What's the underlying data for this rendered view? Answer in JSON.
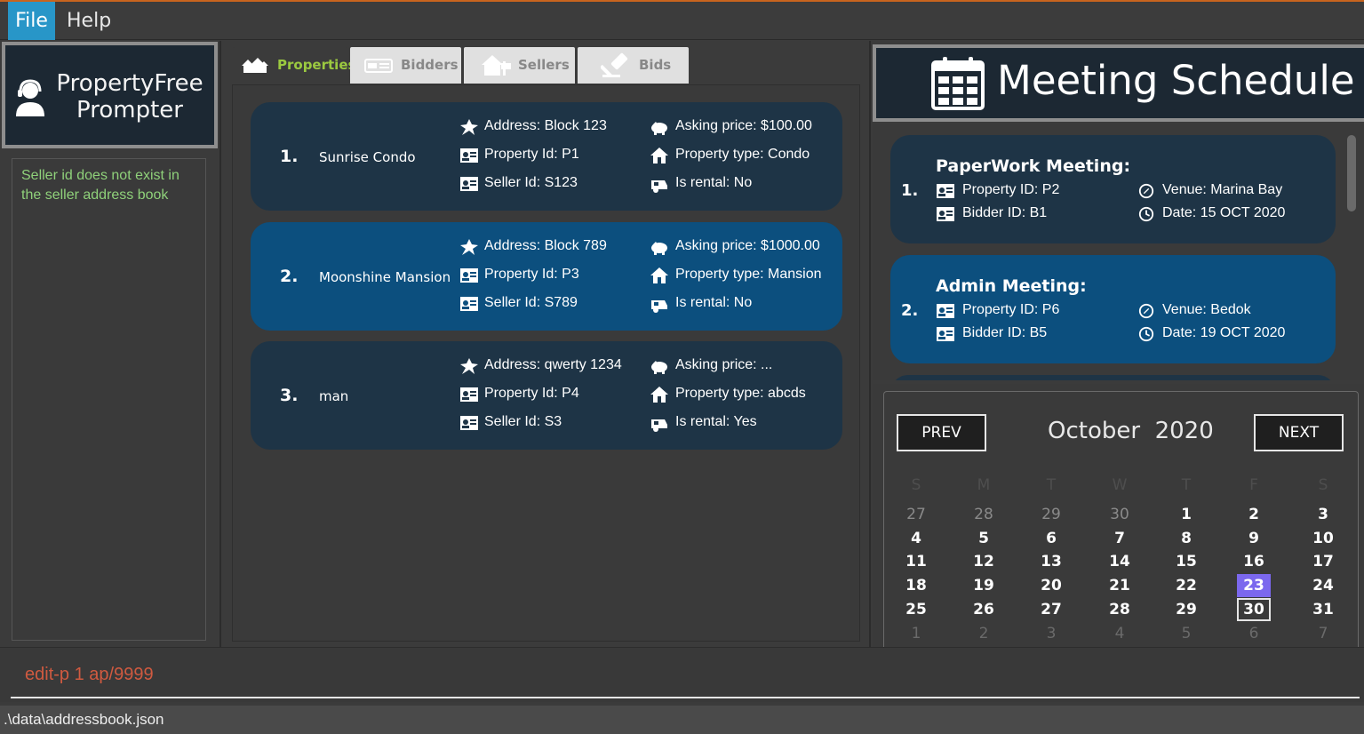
{
  "menu": {
    "items": [
      "File",
      "Help"
    ]
  },
  "app": {
    "title_line1": "PropertyFree",
    "title_line2": "Prompter"
  },
  "result": {
    "message": "Seller id does not exist in the seller address book"
  },
  "tabs": [
    {
      "label": "Properties",
      "icon": "houses-icon",
      "selected": true
    },
    {
      "label": "Bidders",
      "icon": "id-card-icon",
      "selected": false
    },
    {
      "label": "Sellers",
      "icon": "house-sale-icon",
      "selected": false
    },
    {
      "label": "Bids",
      "icon": "gavel-icon",
      "selected": false
    }
  ],
  "properties": [
    {
      "index": "1.",
      "name": "Sunrise Condo",
      "address": "Address: Block 123",
      "property_id": "Property Id: P1",
      "seller_id": "Seller Id: S123",
      "asking_price": "Asking price: $100.00",
      "property_type": "Property type: Condo",
      "is_rental": "Is rental: No",
      "selected": false
    },
    {
      "index": "2.",
      "name": "Moonshine Mansion",
      "address": "Address: Block 789",
      "property_id": "Property Id: P3",
      "seller_id": "Seller Id: S789",
      "asking_price": "Asking price: $1000.00",
      "property_type": "Property type: Mansion",
      "is_rental": "Is rental: No",
      "selected": true
    },
    {
      "index": "3.",
      "name": "man",
      "address": "Address: qwerty 1234",
      "property_id": "Property Id: P4",
      "seller_id": "Seller Id: S3",
      "asking_price": "Asking price: ...",
      "property_type": "Property type: abcds",
      "is_rental": "Is rental: Yes",
      "selected": false
    }
  ],
  "meeting_header": {
    "title": "Meeting Schedule"
  },
  "meetings": [
    {
      "index": "1.",
      "title": "PaperWork Meeting:",
      "property_id": "Property ID: P2",
      "bidder_id": "Bidder ID: B1",
      "venue": "Venue: Marina Bay",
      "date": "Date: 15 OCT 2020",
      "selected": false
    },
    {
      "index": "2.",
      "title": "Admin Meeting:",
      "property_id": "Property ID: P6",
      "bidder_id": "Bidder ID: B5",
      "venue": "Venue: Bedok",
      "date": "Date: 19 OCT 2020",
      "selected": true
    }
  ],
  "calendar": {
    "prev_label": "PREV",
    "next_label": "NEXT",
    "month": "October",
    "year": "2020",
    "weekdays": [
      "S",
      "M",
      "T",
      "W",
      "T",
      "F",
      "S"
    ],
    "weeks": [
      [
        "27",
        "28",
        "29",
        "30",
        "1",
        "2",
        "3"
      ],
      [
        "4",
        "5",
        "6",
        "7",
        "8",
        "9",
        "10"
      ],
      [
        "11",
        "12",
        "13",
        "14",
        "15",
        "16",
        "17"
      ],
      [
        "18",
        "19",
        "20",
        "21",
        "22",
        "23",
        "24"
      ],
      [
        "25",
        "26",
        "27",
        "28",
        "29",
        "30",
        "31"
      ],
      [
        "1",
        "2",
        "3",
        "4",
        "5",
        "6",
        "7"
      ]
    ],
    "today": "23",
    "selected": "30",
    "colors": {
      "today_bg": "#7b68ee"
    }
  },
  "command": {
    "value": "edit-p 1 ap/9999"
  },
  "status": {
    "path": ".\\data\\addressbook.json"
  },
  "colors": {
    "accent_orange": "#c8641e",
    "menu_active": "#2896c8",
    "card": "#1e3446",
    "card_selected": "#0c4f7e",
    "tab_active_text": "#9bc940",
    "result_text": "#8fd17a",
    "command_text": "#d05a40"
  }
}
